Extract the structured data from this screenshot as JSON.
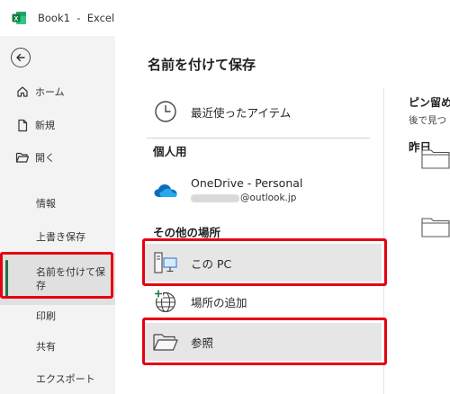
{
  "titlebar": {
    "title": "Book1  -  Excel",
    "logo_icon": "excel-logo-icon"
  },
  "sidebar": {
    "back_icon": "back-arrow-icon",
    "items": [
      {
        "label": "ホーム",
        "icon": "home-icon"
      },
      {
        "label": "新規",
        "icon": "new-file-icon"
      },
      {
        "label": "開く",
        "icon": "open-folder-icon"
      },
      {
        "label": "情報"
      },
      {
        "label": "上書き保存"
      },
      {
        "label": "名前を付けて保\n存",
        "selected": true
      },
      {
        "label": "印刷"
      },
      {
        "label": "共有"
      },
      {
        "label": "エクスポート"
      }
    ]
  },
  "main": {
    "title": "名前を付けて保存",
    "recent": {
      "label": "最近使ったアイテム",
      "icon": "clock-icon"
    },
    "personal_heading": "個人用",
    "onedrive": {
      "label": "OneDrive - Personal",
      "account_suffix": "@outlook.jp",
      "icon": "onedrive-cloud-icon"
    },
    "other_heading": "その他の場所",
    "this_pc": {
      "label": "この PC",
      "icon": "this-pc-icon"
    },
    "add_place": {
      "label": "場所の追加",
      "icon": "globe-add-icon"
    },
    "browse": {
      "label": "参照",
      "icon": "browse-folder-icon"
    }
  },
  "right_panel": {
    "pinned_heading": "ピン留め",
    "pinned_sub": "後で見つ",
    "yesterday_heading": "昨日"
  },
  "colors": {
    "excel_green": "#217346",
    "highlight_red": "#e60012",
    "sidebar_bg": "#f3f3f3",
    "onedrive_blue": "#0f6cbd"
  }
}
